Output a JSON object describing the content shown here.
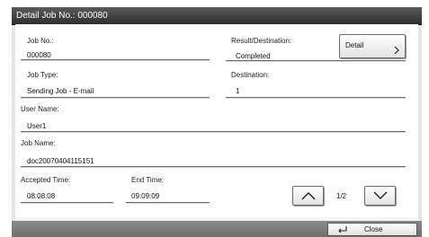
{
  "window": {
    "title": "Detail Job No.: 000080"
  },
  "fields": {
    "job_no_label": "Job No.:",
    "job_no_value": "000080",
    "result_label": "Result/Destination:",
    "result_value": "Completed",
    "job_type_label": "Job Type:",
    "job_type_value": "Sending Job - E-mail",
    "destination_label": "Destination:",
    "destination_value": "1",
    "user_name_label": "User Name:",
    "user_name_value": "User1",
    "job_name_label": "Job Name:",
    "job_name_value": "doc20070404115151",
    "accepted_time_label": "Accepted Time:",
    "accepted_time_value": "08:08:08",
    "end_time_label": "End Time:",
    "end_time_value": "09:09:09"
  },
  "buttons": {
    "detail_label": "Detail",
    "close_label": "Close"
  },
  "pagination": {
    "indicator": "1/2"
  }
}
